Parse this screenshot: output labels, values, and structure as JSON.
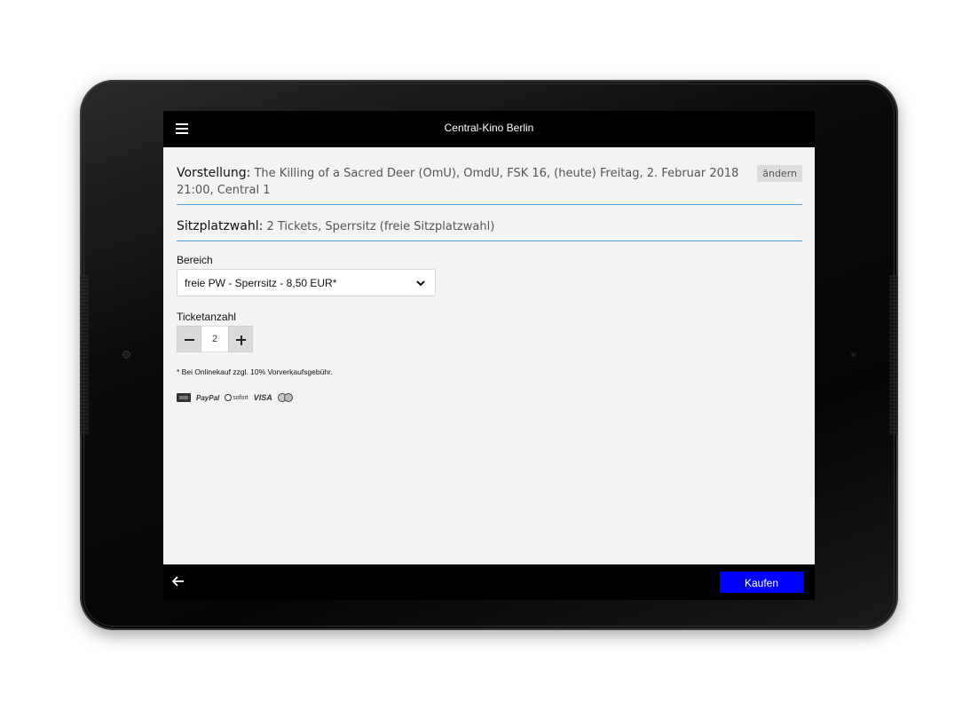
{
  "app": {
    "title": "Central-Kino Berlin",
    "icons": {
      "menu": "hamburger-menu-icon",
      "back": "arrow-left-icon",
      "dropdown": "chevron-down-icon"
    }
  },
  "show": {
    "label": "Vorstellung:",
    "value": "The Killing of a Sacred Deer (OmU), OmdU, FSK 16, (heute) Freitag, 2. Februar 2018 21:00, Central 1",
    "change_label": "ändern"
  },
  "seat": {
    "label": "Sitzplatzwahl:",
    "value": "2 Tickets, Sperrsitz (freie Sitzplatzwahl)"
  },
  "area": {
    "label": "Bereich",
    "selected": "freie PW - Sperrsitz - 8,50 EUR*"
  },
  "tickets": {
    "label": "Ticketanzahl",
    "count": "2"
  },
  "footnote": "* Bei Onlinekauf zzgl. 10% Vorverkaufsgebühr.",
  "payments": {
    "paypal": "PayPal",
    "sofort": "sofort",
    "visa": "VISA"
  },
  "footer": {
    "buy_label": "Kaufen"
  },
  "colors": {
    "accent_line": "#4a9fe0",
    "buy_button": "#0000ff",
    "bar_background": "#000000",
    "screen_background": "#f3f3f3"
  }
}
